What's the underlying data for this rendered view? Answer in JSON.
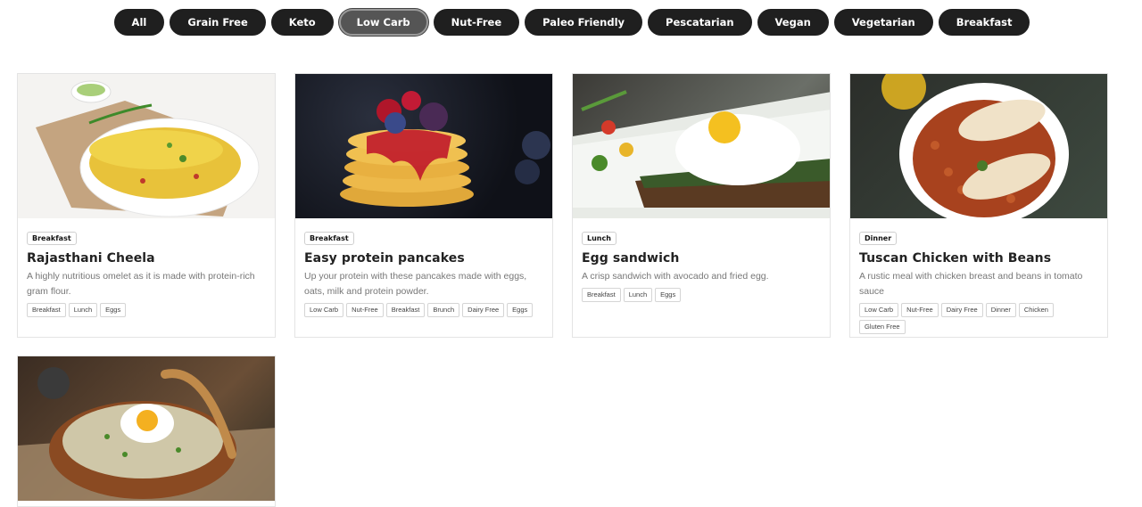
{
  "filters": [
    {
      "label": "All",
      "active": false
    },
    {
      "label": "Grain Free",
      "active": false
    },
    {
      "label": "Keto",
      "active": false
    },
    {
      "label": "Low Carb",
      "active": true
    },
    {
      "label": "Nut-Free",
      "active": false
    },
    {
      "label": "Paleo Friendly",
      "active": false
    },
    {
      "label": "Pescatarian",
      "active": false
    },
    {
      "label": "Vegan",
      "active": false
    },
    {
      "label": "Vegetarian",
      "active": false
    },
    {
      "label": "Breakfast",
      "active": false
    }
  ],
  "recipes": [
    {
      "category": "Breakfast",
      "title": "Rajasthani Cheela",
      "description": "A highly nutritious omelet as it is made with protein-rich gram flour.",
      "tags": [
        "Breakfast",
        "Lunch",
        "Eggs"
      ]
    },
    {
      "category": "Breakfast",
      "title": "Easy protein pancakes",
      "description": "Up your protein with these pancakes made with eggs, oats, milk and protein powder.",
      "tags": [
        "Low Carb",
        "Nut-Free",
        "Breakfast",
        "Brunch",
        "Dairy Free",
        "Eggs"
      ]
    },
    {
      "category": "Lunch",
      "title": "Egg sandwich",
      "description": "A crisp sandwich with avocado and fried egg.",
      "tags": [
        "Breakfast",
        "Lunch",
        "Eggs"
      ]
    },
    {
      "category": "Dinner",
      "title": "Tuscan Chicken with Beans",
      "description": "A rustic meal with chicken breast and beans in tomato sauce",
      "tags": [
        "Low Carb",
        "Nut-Free",
        "Dairy Free",
        "Dinner",
        "Chicken",
        "Gluten Free"
      ]
    },
    {
      "category": "",
      "title": "",
      "description": "",
      "tags": []
    }
  ]
}
